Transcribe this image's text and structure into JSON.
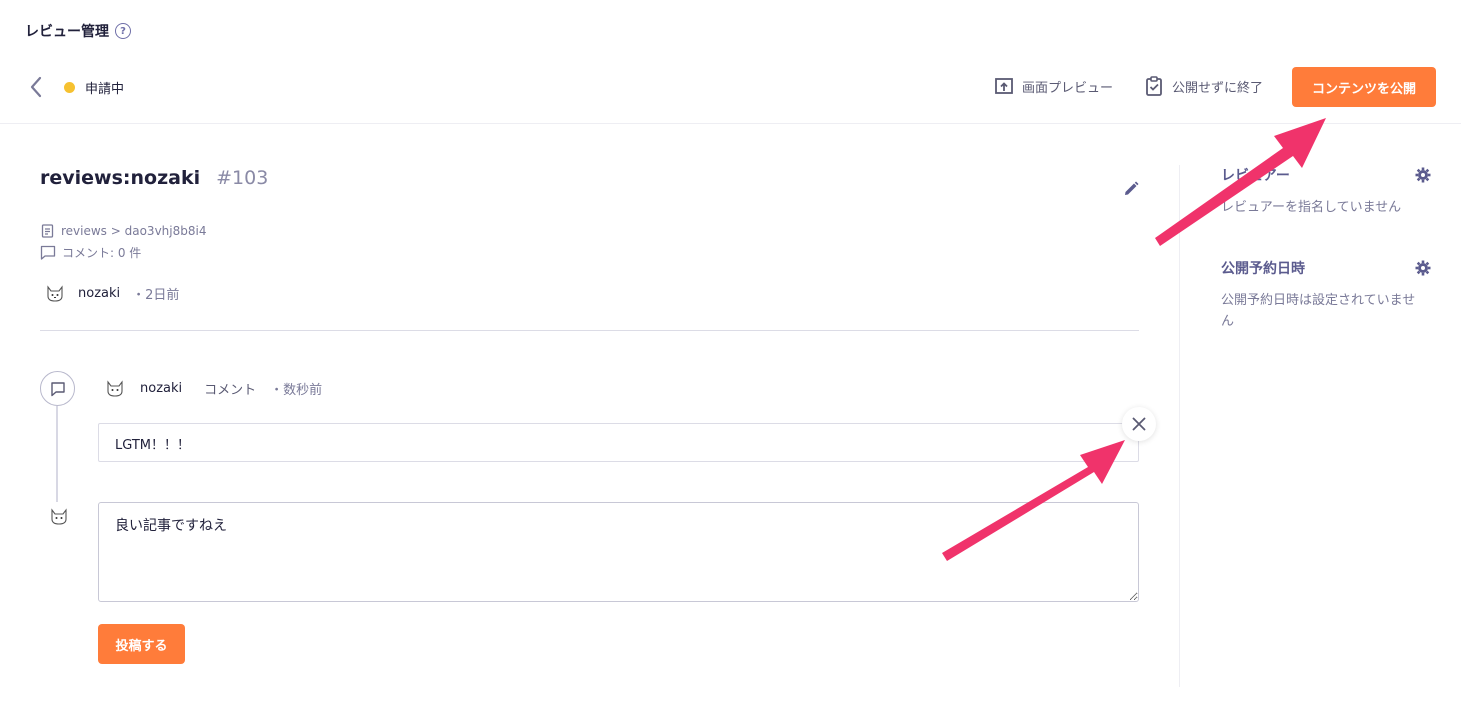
{
  "page": {
    "title": "レビュー管理",
    "help_icon_glyph": "?"
  },
  "header": {
    "status_label": "申請中",
    "status_color": "#f6c130",
    "preview_label": "画面プレビュー",
    "exit_label": "公開せずに終了",
    "publish_label": "コンテンツを公開",
    "accent_color": "#ff7c3a"
  },
  "content": {
    "title": "reviews:nozaki",
    "id": "#103",
    "path": "reviews > dao3vhj8b8i4",
    "comment_count": "コメント: 0 件",
    "author": "nozaki",
    "time": "・2日前"
  },
  "comment": {
    "author": "nozaki",
    "kind": "コメント",
    "time": "・数秒前",
    "body": "LGTM！！！"
  },
  "reply": {
    "value": "良い記事ですねえ",
    "submit_label": "投稿する"
  },
  "sidebar": {
    "reviewers_title": "レビュアー",
    "reviewers_text": "レビュアーを指名していません",
    "schedule_title": "公開予約日時",
    "schedule_text": "公開予約日時は設定されていません"
  },
  "icons": [
    "help-icon",
    "chevron-left-icon",
    "preview-icon",
    "clipboard-check-icon",
    "pencil-icon",
    "clipboard-icon",
    "comment-icon",
    "cat-avatar-icon",
    "close-icon",
    "gear-icon",
    "arrow-annotation"
  ]
}
